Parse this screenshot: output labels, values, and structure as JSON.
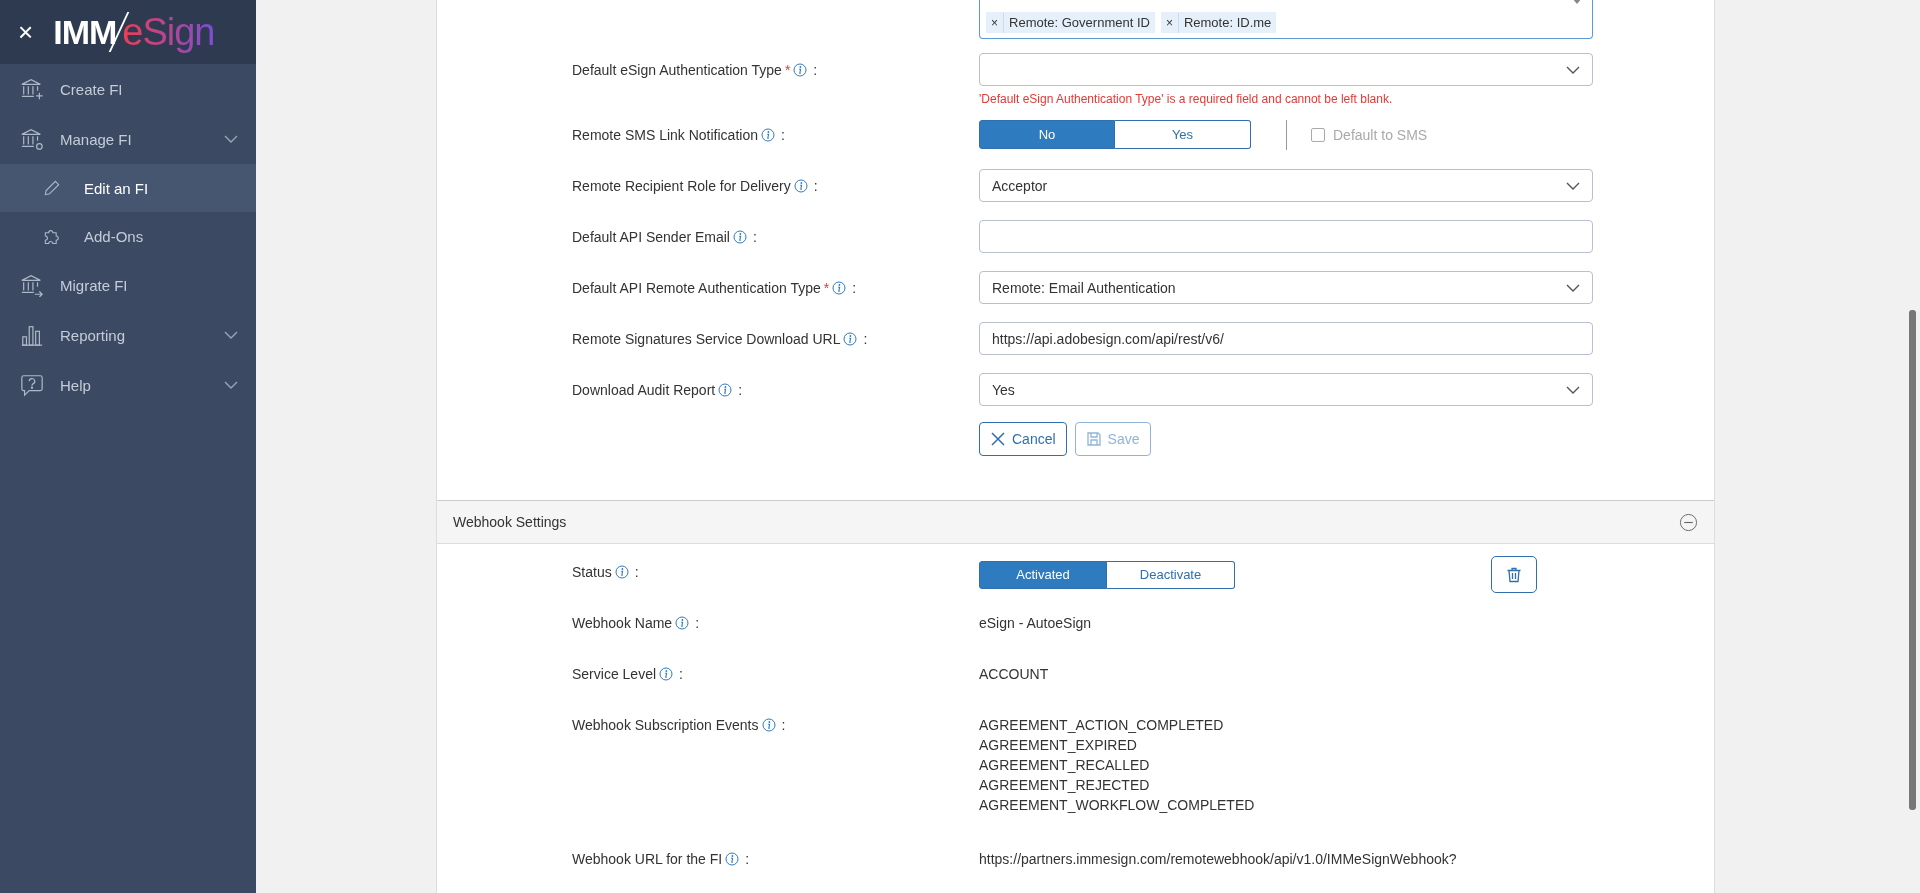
{
  "sidebar": {
    "close": "×",
    "logo": {
      "prefix": "IMM",
      "suffix": "eSign"
    },
    "items": [
      {
        "kind": "create",
        "label": "Create FI",
        "expandable": false,
        "selected": false
      },
      {
        "kind": "manage",
        "label": "Manage FI",
        "expandable": true,
        "selected": false,
        "children": [
          {
            "kind": "edit",
            "label": "Edit an FI",
            "selected": true
          },
          {
            "kind": "addons",
            "label": "Add-Ons",
            "selected": false
          }
        ]
      },
      {
        "kind": "migrate",
        "label": "Migrate FI",
        "expandable": false,
        "selected": false
      },
      {
        "kind": "reporting",
        "label": "Reporting",
        "expandable": true,
        "selected": false
      },
      {
        "kind": "help",
        "label": "Help",
        "expandable": true,
        "selected": false
      }
    ]
  },
  "form": {
    "fields": [
      {
        "kind": "chips",
        "chips": [
          "Remote: Government ID",
          "Remote: ID.me"
        ],
        "remove": "×"
      },
      {
        "kind": "select",
        "label": "Default eSign Authentication Type",
        "required_mark": "*",
        "colon": ":",
        "error": "'Default eSign Authentication Type' is a required field and cannot be left blank."
      },
      {
        "kind": "toggle",
        "label": "Remote SMS Link Notification",
        "colon": ":",
        "options": [
          {
            "label": "No",
            "selected": true
          },
          {
            "label": "Yes",
            "selected": false
          }
        ],
        "checkbox": {
          "label": "Default to SMS",
          "checked": false,
          "disabled": true
        }
      },
      {
        "kind": "select",
        "label": "Remote Recipient Role for Delivery",
        "colon": ":",
        "value": "Acceptor"
      },
      {
        "kind": "text",
        "label": "Default API Sender Email",
        "colon": ":"
      },
      {
        "kind": "select",
        "label": "Default API Remote Authentication Type",
        "required_mark": "*",
        "colon": ":",
        "value": "Remote: Email Authentication"
      },
      {
        "kind": "text",
        "label": "Remote Signatures Service Download URL",
        "colon": ":",
        "value": "https://api.adobesign.com/api/rest/v6/"
      },
      {
        "kind": "select",
        "label": "Download Audit Report",
        "colon": ":",
        "value": "Yes"
      }
    ],
    "buttons": [
      {
        "kind": "cancel",
        "label": "Cancel",
        "disabled": false
      },
      {
        "kind": "save",
        "label": "Save",
        "disabled": true
      }
    ]
  },
  "webhook": {
    "title": "Webhook Settings",
    "expanded": true,
    "rows": [
      {
        "kind": "toggle",
        "label": "Status",
        "colon": ":",
        "options": [
          {
            "label": "Activated",
            "selected": true
          },
          {
            "label": "Deactivate",
            "selected": false
          }
        ]
      },
      {
        "kind": "value",
        "label": "Webhook Name",
        "colon": ":",
        "lines": [
          "eSign - AutoeSign"
        ]
      },
      {
        "kind": "value",
        "label": "Service Level",
        "colon": ":",
        "lines": [
          "ACCOUNT"
        ]
      },
      {
        "kind": "value",
        "label": "Webhook Subscription Events",
        "colon": ":",
        "lines": [
          "AGREEMENT_ACTION_COMPLETED",
          "AGREEMENT_EXPIRED",
          "AGREEMENT_RECALLED",
          "AGREEMENT_REJECTED",
          "AGREEMENT_WORKFLOW_COMPLETED"
        ]
      },
      {
        "kind": "value",
        "label": "Webhook URL for the FI",
        "colon": ":",
        "lines": [
          "https://partners.immesign.com/remotewebhook/api/v1.0/IMMeSignWebhook?"
        ]
      }
    ]
  }
}
